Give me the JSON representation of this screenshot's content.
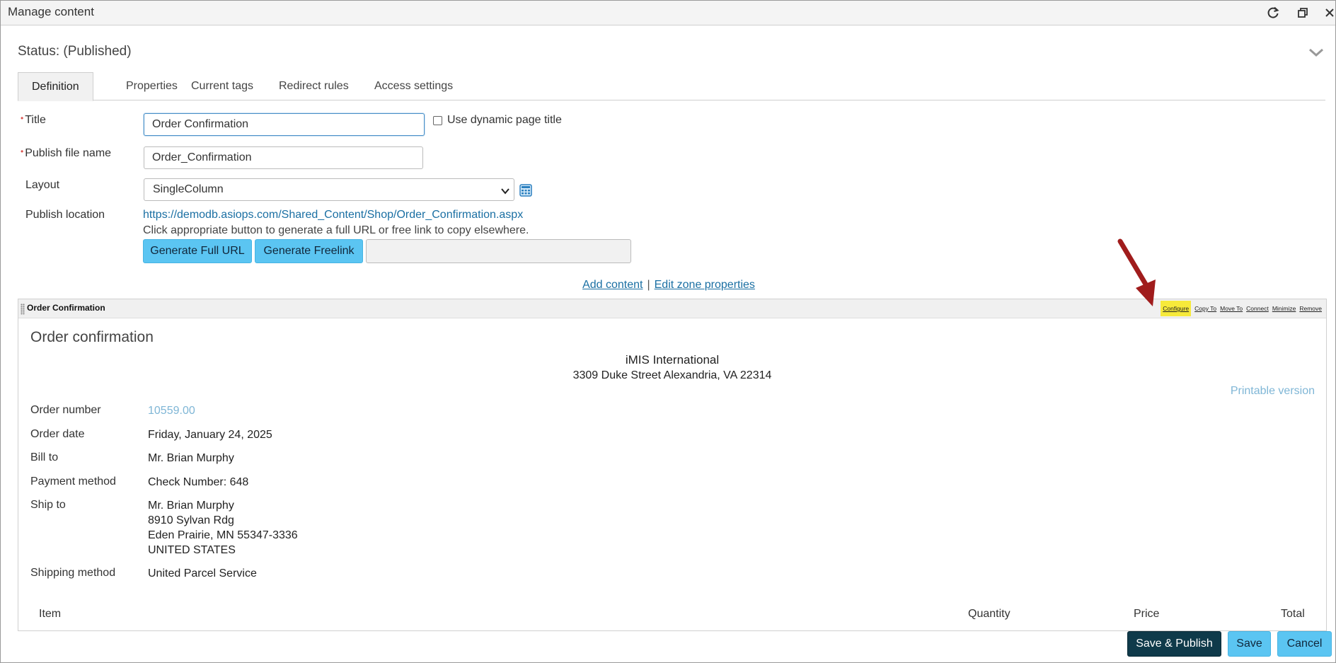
{
  "window": {
    "title": "Manage content"
  },
  "status": "Status: (Published)",
  "tabs": [
    {
      "label": "Definition",
      "active": true
    },
    {
      "label": "Properties",
      "active": false
    },
    {
      "label": "Current tags",
      "active": false
    },
    {
      "label": "Redirect rules",
      "active": false
    },
    {
      "label": "Access settings",
      "active": false
    }
  ],
  "form": {
    "title_label": "Title",
    "title_value": "Order Confirmation",
    "dynamic_title_label": "Use dynamic page title",
    "publish_file_label": "Publish file name",
    "publish_file_value": "Order_Confirmation",
    "layout_label": "Layout",
    "layout_value": "SingleColumn",
    "publish_location_label": "Publish location",
    "publish_location_url": "https://demodb.asiops.com/Shared_Content/Shop/Order_Confirmation.aspx",
    "publish_hint": "Click appropriate button to generate a full URL or free link to copy elsewhere.",
    "generate_full_url": "Generate Full URL",
    "generate_freelink": "Generate Freelink"
  },
  "zone_links": {
    "add_content": "Add content",
    "sep": "|",
    "edit_zone": "Edit zone properties"
  },
  "part": {
    "title": "Order Confirmation",
    "actions": [
      "Configure",
      "Copy To",
      "Move To",
      "Connect",
      "Minimize",
      "Remove"
    ],
    "heading": "Order confirmation",
    "org_name": "iMIS International",
    "org_address": "3309 Duke Street Alexandria, VA 22314",
    "printable": "Printable version",
    "fields": {
      "order_number_label": "Order number",
      "order_number_value": "10559.00",
      "order_date_label": "Order date",
      "order_date_value": "Friday, January 24, 2025",
      "bill_to_label": "Bill to",
      "bill_to_value": "Mr. Brian Murphy",
      "payment_label": "Payment method",
      "payment_value": "Check Number: 648",
      "ship_to_label": "Ship to",
      "ship_to_lines": [
        "Mr. Brian Murphy",
        "8910 Sylvan Rdg",
        "Eden Prairie, MN 55347-3336",
        "UNITED STATES"
      ],
      "shipping_method_label": "Shipping method",
      "shipping_method_value": "United Parcel Service"
    },
    "columns": [
      "Item",
      "Quantity",
      "Price",
      "Total"
    ]
  },
  "buttons": {
    "save_publish": "Save & Publish",
    "save": "Save",
    "cancel": "Cancel"
  },
  "colors": {
    "accent": "#5bc5f2",
    "dark_button": "#0f3a4a",
    "highlight": "#f7ea3b",
    "annotation_arrow": "#a01c1c"
  }
}
